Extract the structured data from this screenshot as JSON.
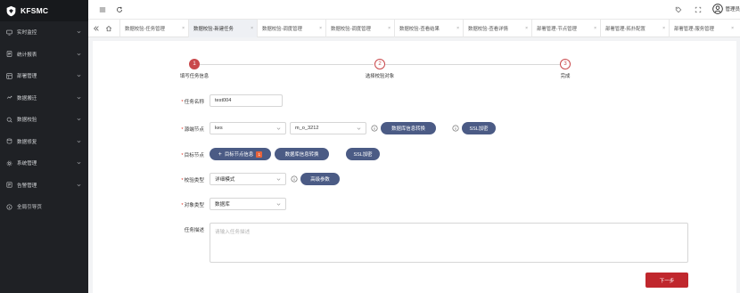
{
  "app": {
    "logo_text": "KFSMC"
  },
  "sidebar": {
    "items": [
      {
        "label": "实时监控",
        "icon": "monitor-icon"
      },
      {
        "label": "统计报表",
        "icon": "report-icon"
      },
      {
        "label": "部署管理",
        "icon": "deploy-icon"
      },
      {
        "label": "数据搬迁",
        "icon": "migrate-icon"
      },
      {
        "label": "数据校验",
        "icon": "verify-icon"
      },
      {
        "label": "数据修复",
        "icon": "repair-icon"
      },
      {
        "label": "系统管理",
        "icon": "settings-icon"
      },
      {
        "label": "告警管理",
        "icon": "alarm-icon"
      },
      {
        "label": "全局引导页",
        "icon": "guide-icon"
      }
    ]
  },
  "topbar": {
    "user_name": "管理员"
  },
  "tabs": [
    {
      "label": "数据校验-任务管理",
      "active": false
    },
    {
      "label": "数据校验-新建任务",
      "active": true
    },
    {
      "label": "数据校验-调度管理",
      "active": false
    },
    {
      "label": "数据校验-调度管理",
      "active": false
    },
    {
      "label": "数据校验-查看结果",
      "active": false
    },
    {
      "label": "数据校验-查看详情",
      "active": false
    },
    {
      "label": "部署管理-节点管理",
      "active": false
    },
    {
      "label": "部署管理-拓扑配置",
      "active": false
    },
    {
      "label": "部署管理-服务管理",
      "active": false
    }
  ],
  "tab_close": "×",
  "steps": [
    {
      "num": "1",
      "label": "填写任务信息",
      "done": true
    },
    {
      "num": "2",
      "label": "选择校验对象",
      "done": false
    },
    {
      "num": "3",
      "label": "完成",
      "done": false
    }
  ],
  "form": {
    "required_mark": "*",
    "task_name": {
      "label": "任务名称",
      "value": "test004"
    },
    "source_node": {
      "label": "源端节点",
      "value1": "kes",
      "value2": "m_o_3212",
      "btn_convert": "数据库信息转换",
      "btn_ssl": "SSL加密"
    },
    "target_node": {
      "label": "目标节点",
      "btn_target": "目标节点信息",
      "badge": "1",
      "btn_convert": "数据库信息转换",
      "btn_ssl": "SSL加密"
    },
    "verify_type": {
      "label": "校验类型",
      "value": "详细模式",
      "btn_advanced": "高级参数"
    },
    "object_type": {
      "label": "对象类型",
      "value": "数据库"
    },
    "task_desc": {
      "label": "任务描述",
      "placeholder": "请输入任务描述"
    }
  },
  "buttons": {
    "next": "下一步"
  },
  "colors": {
    "accent": "#c9484b",
    "pill": "#4b5b85",
    "next": "#c0272d",
    "sidebar": "#1f2125"
  }
}
